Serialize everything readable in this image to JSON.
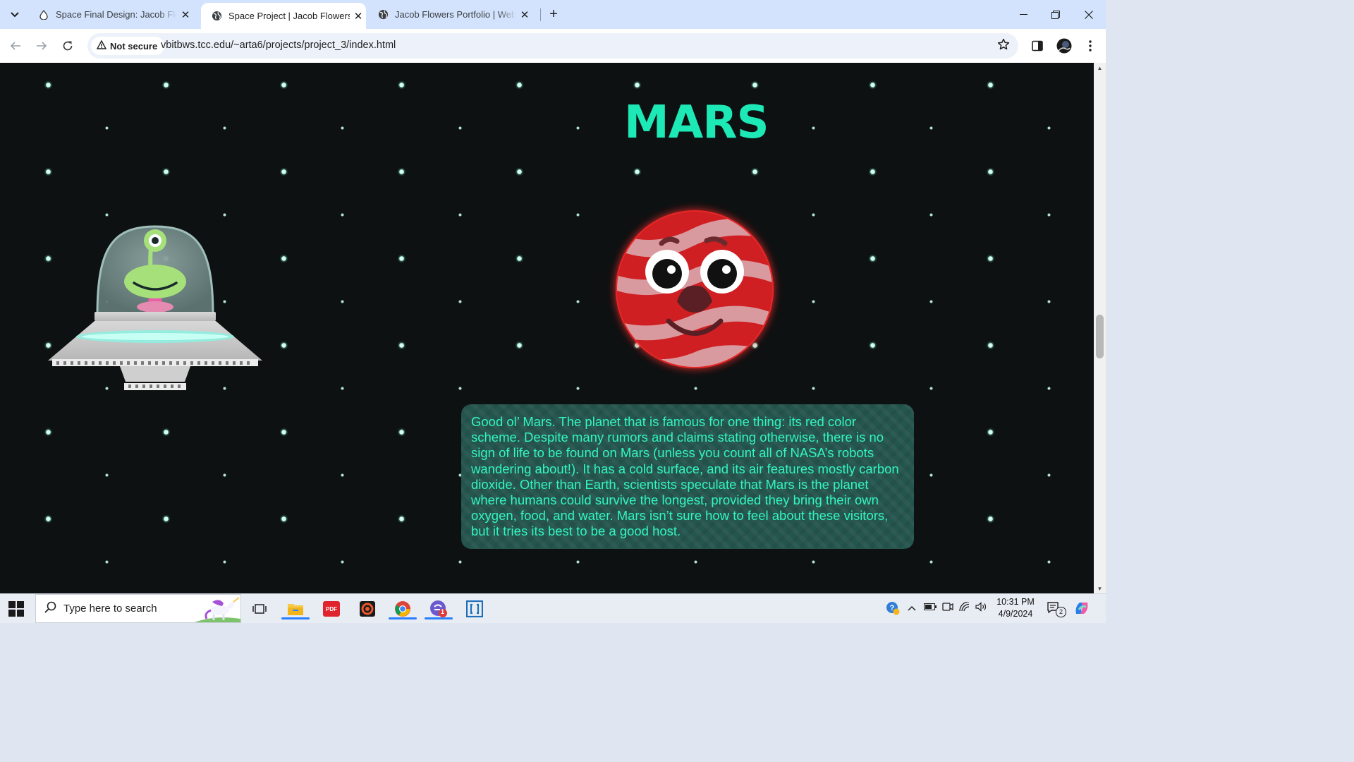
{
  "browser": {
    "tabs": [
      {
        "title": "Space Final Design: Jacob Flowers",
        "active": false
      },
      {
        "title": "Space Project | Jacob Flowers",
        "active": true
      },
      {
        "title": "Jacob Flowers Portfolio | Web Portfolio",
        "active": false
      }
    ],
    "security_label": "Not secure",
    "url": "vbitbws.tcc.edu/~arta6/projects/project_3/index.html",
    "icons": [
      "tab-search-icon",
      "new-tab-icon",
      "minimize-icon",
      "restore-icon",
      "close-icon",
      "back-icon",
      "forward-icon",
      "reload-icon",
      "warning-icon",
      "bookmark-star-icon",
      "side-panel-icon",
      "profile-avatar-icon",
      "menu-kebab-icon"
    ]
  },
  "page": {
    "heading": "MARS",
    "description": "Good ol’ Mars. The planet that is famous for one thing: its red color scheme. Despite many rumors and claims stating otherwise, there is no sign of life to be found on Mars (unless you count all of NASA’s robots wandering about!). It has a cold surface, and its air features mostly carbon dioxide. Other than Earth, scientists speculate that Mars is the planet where humans could survive the longest, provided they bring their own oxygen, food, and water. Mars isn’t sure how to feel about these visitors, but it tries its best to be a good host.",
    "colors": {
      "heading": "#1de9b6",
      "text": "#33f5bf",
      "panel": "#25564e",
      "background": "#0e1112"
    },
    "images": [
      "alien-ufo-illustration",
      "mars-cartoon-face-illustration"
    ]
  },
  "taskbar": {
    "search_placeholder": "Type here to search",
    "apps": [
      "task-view-icon",
      "file-explorer-icon",
      "pdf-app-icon",
      "media-app-icon",
      "chrome-icon",
      "messenger-app-icon",
      "brackets-app-icon"
    ],
    "badges": {
      "messenger": "1",
      "notifications": "2"
    },
    "time": "10:31 PM",
    "date": "4/9/2024"
  }
}
